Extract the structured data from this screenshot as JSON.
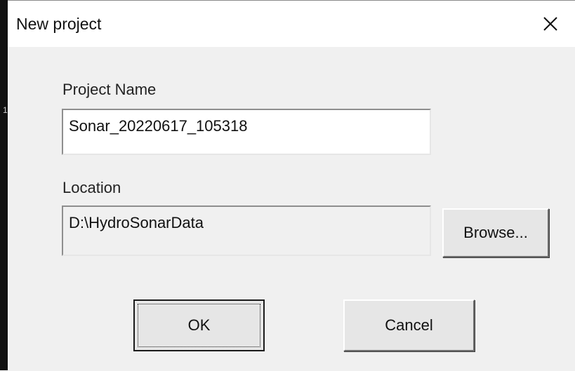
{
  "window": {
    "title": "New project",
    "close_icon": "close-icon"
  },
  "form": {
    "project_name_label": "Project Name",
    "project_name_value": "Sonar_20220617_105318",
    "location_label": "Location",
    "location_value": "D:\\HydroSonarData"
  },
  "buttons": {
    "browse_label": "Browse...",
    "ok_label": "OK",
    "cancel_label": "Cancel"
  },
  "background": {
    "edge_mark": "1"
  },
  "colors": {
    "dialog_background": "#f0f0f0",
    "title_background": "#ffffff",
    "text": "#111111"
  }
}
